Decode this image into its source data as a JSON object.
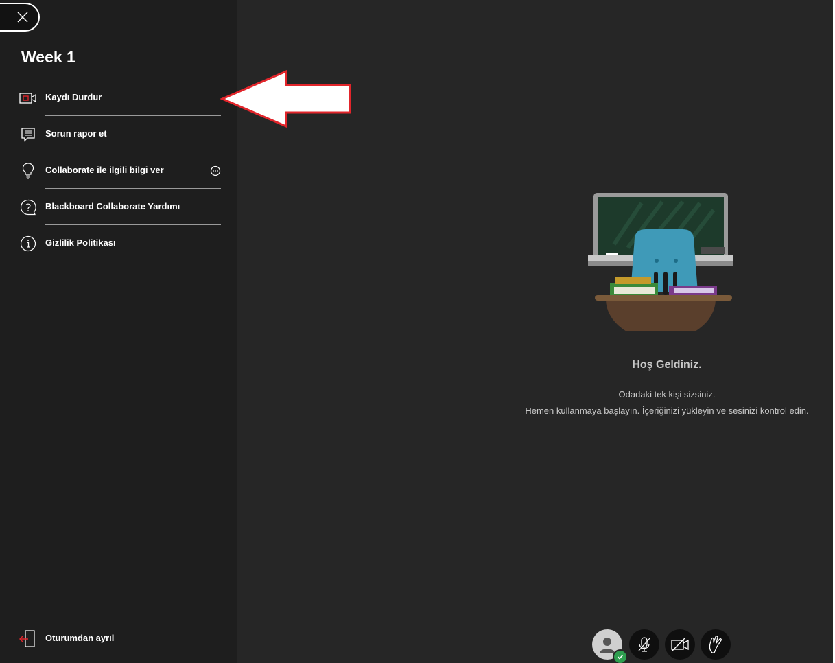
{
  "panel": {
    "title": "Week 1",
    "menu_items": [
      {
        "label": "Kaydı Durdur",
        "icon": "record-stop-icon"
      },
      {
        "label": "Sorun rapor et",
        "icon": "report-icon"
      },
      {
        "label": "Collaborate ile ilgili bilgi ver",
        "icon": "lightbulb-icon",
        "extra_icon": "more-options-icon"
      },
      {
        "label": "Blackboard Collaborate Yardımı",
        "icon": "help-icon"
      },
      {
        "label": "Gizlilik Politikası",
        "icon": "info-icon"
      }
    ],
    "leave_label": "Oturumdan ayrıl",
    "leave_icon": "exit-icon"
  },
  "main": {
    "welcome_title": "Hoş Geldiniz.",
    "welcome_line_1": "Odadaki tek kişi sizsiniz.",
    "welcome_line_2": "Hemen kullanmaya başlayın. İçeriğinizi yükleyin ve sesinizi kontrol edin."
  },
  "controls": [
    {
      "icon": "avatar-icon"
    },
    {
      "icon": "mic-off-icon"
    },
    {
      "icon": "camera-off-icon"
    },
    {
      "icon": "raise-hand-icon"
    }
  ],
  "colors": {
    "background": "#262626",
    "panel": "#1e1e1e",
    "accent_red": "#e2252b",
    "status_green": "#2e9e4f"
  }
}
